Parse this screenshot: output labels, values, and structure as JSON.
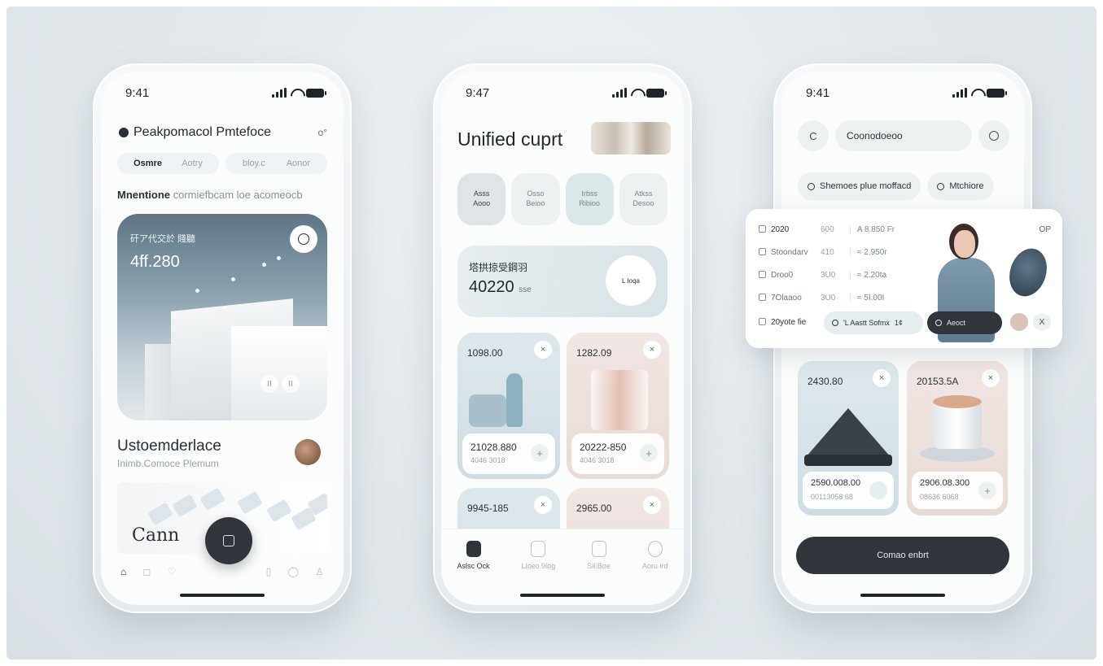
{
  "phones": [
    {
      "status_time": "9:41",
      "title": "Peakpomacol Pmtefoce",
      "tabs": [
        "Osmre",
        "Aotry",
        "bloy.c",
        "Aonor"
      ],
      "subtitle_bold": "Mnentione",
      "subtitle_rest": "cormiefbcam  loe acomeocb",
      "hero_label": "矸ア代交於 賤聽",
      "hero_value": "4ff.280",
      "section_title": "Ustoemderlace",
      "section_subtitle": "Inimb.Comoce Plemum",
      "strip_caption": "Cann"
    },
    {
      "status_time": "9:47",
      "title": "Unified cuprt",
      "categories": [
        {
          "line1": "Asss",
          "line2": "Aooo"
        },
        {
          "line1": "Osso",
          "line2": "Beioo"
        },
        {
          "line1": "Irbss",
          "line2": "Ribioo"
        },
        {
          "line1": "Atkss",
          "line2": "Desoo"
        }
      ],
      "banner_label": "塔拱掠受鋼羽",
      "banner_value": "40220",
      "banner_unit": "sse",
      "banner_badge": "L Ioqa",
      "cards": [
        {
          "value": "1098.00",
          "foot_a": "21028.880",
          "foot_b": "4046 3018"
        },
        {
          "value": "1282.09",
          "foot_a": "20222-850",
          "foot_b": "4046 3018"
        },
        {
          "value": "9945-185",
          "foot_a": "",
          "foot_b": ""
        },
        {
          "value": "2965.00",
          "foot_a": "",
          "foot_b": ""
        }
      ],
      "nav": [
        "Aslsc Ock",
        "Lloeo 9log",
        "Sil.Boe",
        "Aoru ird"
      ]
    },
    {
      "status_time": "9:41",
      "search_value": "Coonodoeoo",
      "chips": [
        "Shemoes plue moffacd",
        "Mtchiore"
      ],
      "cards": [
        {
          "value": "2430.80",
          "foot_a": "2590.008.00",
          "foot_b": "00113058 68"
        },
        {
          "value": "20153.5A",
          "foot_a": "2906.08.300",
          "foot_b": "08636 6068"
        }
      ],
      "primary_button": "Comao enbrt"
    }
  ],
  "overlay": {
    "rows": [
      {
        "k": "2020",
        "m": "600",
        "r": "A 8.850 Fr"
      },
      {
        "k": "Stoondarv",
        "m": "410",
        "r": "≈ 2.950r"
      },
      {
        "k": "Droo0",
        "m": "3U0",
        "r": "≈ 2.20ta"
      },
      {
        "k": "7Olaaoo",
        "m": "3U0",
        "r": "≈ 5I.00I"
      }
    ],
    "last_row": "20yote fie",
    "pill_light": "'L Aastt Sofmx",
    "pill_light_count": "1¢",
    "pill_dark": "Aeoct",
    "corner_label": "OP",
    "close": "X"
  },
  "icons": {
    "close": "×",
    "plus": "+",
    "back": "C"
  }
}
